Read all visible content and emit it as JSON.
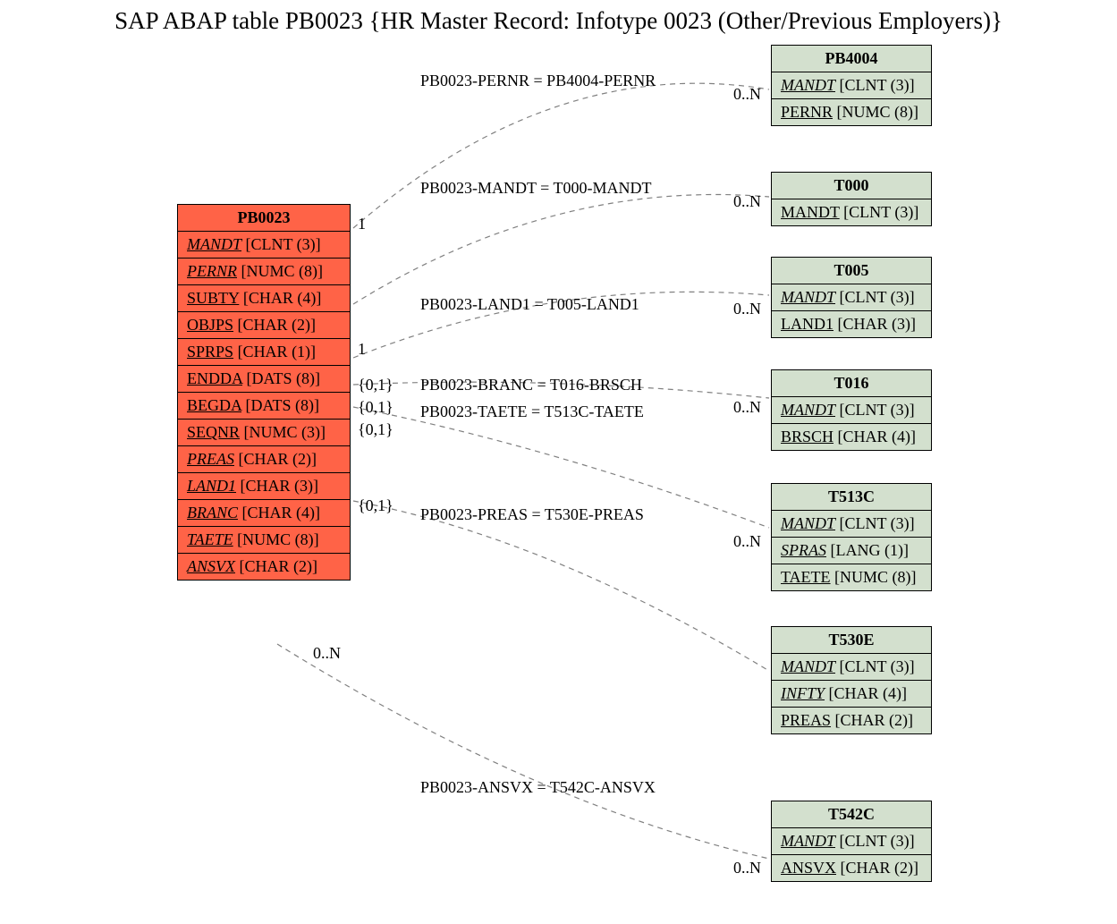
{
  "title": "SAP ABAP table PB0023 {HR Master Record: Infotype 0023 (Other/Previous Employers)}",
  "main": {
    "name": "PB0023",
    "fields": [
      {
        "name": "MANDT",
        "type": "[CLNT (3)]",
        "italic": true
      },
      {
        "name": "PERNR",
        "type": "[NUMC (8)]",
        "italic": true
      },
      {
        "name": "SUBTY",
        "type": "[CHAR (4)]",
        "italic": false
      },
      {
        "name": "OBJPS",
        "type": "[CHAR (2)]",
        "italic": false
      },
      {
        "name": "SPRPS",
        "type": "[CHAR (1)]",
        "italic": false
      },
      {
        "name": "ENDDA",
        "type": "[DATS (8)]",
        "italic": false
      },
      {
        "name": "BEGDA",
        "type": "[DATS (8)]",
        "italic": false
      },
      {
        "name": "SEQNR",
        "type": "[NUMC (3)]",
        "italic": false
      },
      {
        "name": "PREAS",
        "type": "[CHAR (2)]",
        "italic": true
      },
      {
        "name": "LAND1",
        "type": "[CHAR (3)]",
        "italic": true
      },
      {
        "name": "BRANC",
        "type": "[CHAR (4)]",
        "italic": true
      },
      {
        "name": "TAETE",
        "type": "[NUMC (8)]",
        "italic": true
      },
      {
        "name": "ANSVX",
        "type": "[CHAR (2)]",
        "italic": true
      }
    ]
  },
  "refs": [
    {
      "name": "PB4004",
      "fields": [
        {
          "name": "MANDT",
          "type": "[CLNT (3)]",
          "italic": true
        },
        {
          "name": "PERNR",
          "type": "[NUMC (8)]",
          "italic": false
        }
      ]
    },
    {
      "name": "T000",
      "fields": [
        {
          "name": "MANDT",
          "type": "[CLNT (3)]",
          "italic": false
        }
      ]
    },
    {
      "name": "T005",
      "fields": [
        {
          "name": "MANDT",
          "type": "[CLNT (3)]",
          "italic": true
        },
        {
          "name": "LAND1",
          "type": "[CHAR (3)]",
          "italic": false
        }
      ]
    },
    {
      "name": "T016",
      "fields": [
        {
          "name": "MANDT",
          "type": "[CLNT (3)]",
          "italic": true
        },
        {
          "name": "BRSCH",
          "type": "[CHAR (4)]",
          "italic": false
        }
      ]
    },
    {
      "name": "T513C",
      "fields": [
        {
          "name": "MANDT",
          "type": "[CLNT (3)]",
          "italic": true
        },
        {
          "name": "SPRAS",
          "type": "[LANG (1)]",
          "italic": true
        },
        {
          "name": "TAETE",
          "type": "[NUMC (8)]",
          "italic": false
        }
      ]
    },
    {
      "name": "T530E",
      "fields": [
        {
          "name": "MANDT",
          "type": "[CLNT (3)]",
          "italic": true
        },
        {
          "name": "INFTY",
          "type": "[CHAR (4)]",
          "italic": true
        },
        {
          "name": "PREAS",
          "type": "[CHAR (2)]",
          "italic": false
        }
      ]
    },
    {
      "name": "T542C",
      "fields": [
        {
          "name": "MANDT",
          "type": "[CLNT (3)]",
          "italic": true
        },
        {
          "name": "ANSVX",
          "type": "[CHAR (2)]",
          "italic": false
        }
      ]
    }
  ],
  "edges": [
    {
      "label": "PB0023-PERNR = PB4004-PERNR",
      "srcCard": "1",
      "dstCard": "0..N"
    },
    {
      "label": "PB0023-MANDT = T000-MANDT",
      "srcCard": "",
      "dstCard": "0..N"
    },
    {
      "label": "PB0023-LAND1 = T005-LAND1",
      "srcCard": "1",
      "dstCard": "0..N"
    },
    {
      "label": "PB0023-BRANC = T016-BRSCH",
      "srcCard": "{0,1}",
      "dstCard": "0..N"
    },
    {
      "label": "PB0023-TAETE = T513C-TAETE",
      "srcCard": "{0,1}",
      "dstCard": ""
    },
    {
      "label": "PB0023-PREAS = T530E-PREAS",
      "srcCard": "{0,1}",
      "dstCard": "0..N"
    },
    {
      "label": "PB0023-ANSVX = T542C-ANSVX",
      "srcCard": "{0,1}",
      "dstCard": "0..N"
    }
  ],
  "extraCard": "0..N"
}
